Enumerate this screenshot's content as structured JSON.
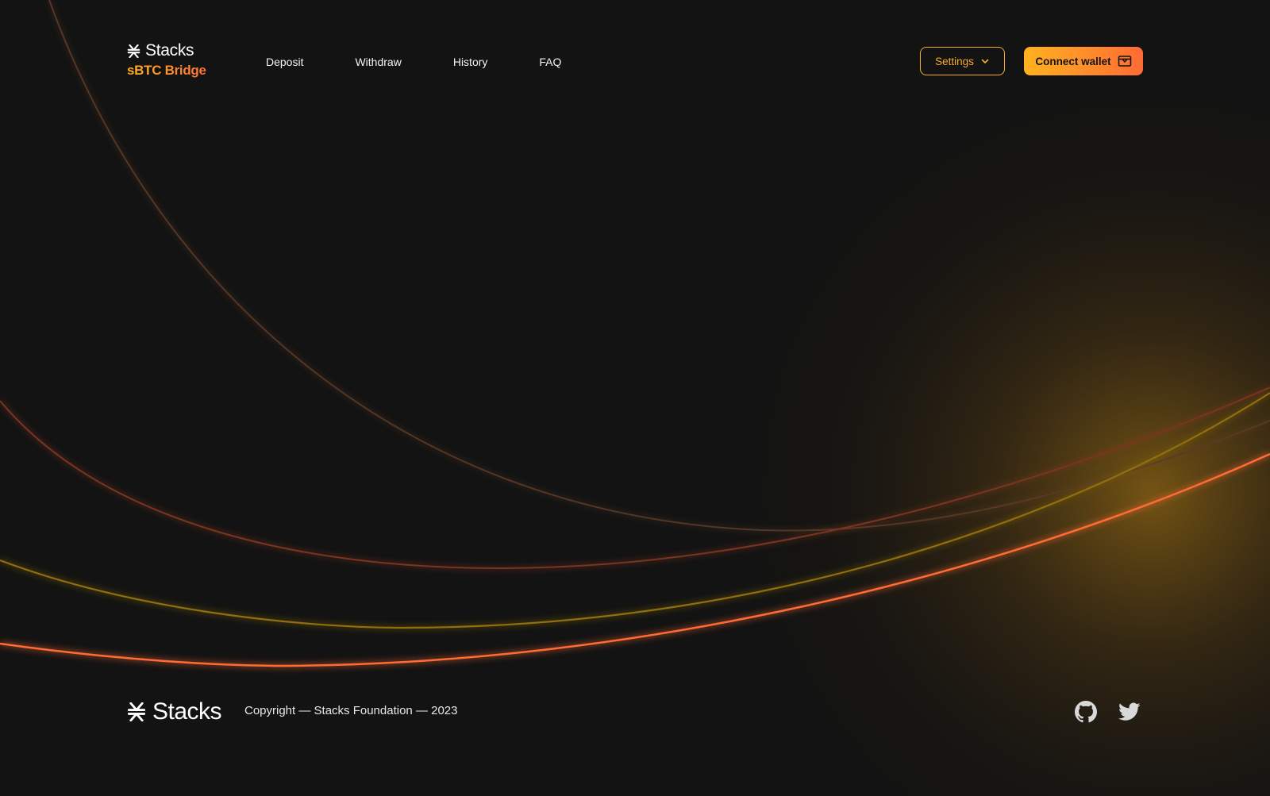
{
  "header": {
    "brand_name": "Stacks",
    "brand_sub": "sBTC Bridge",
    "nav": [
      {
        "label": "Deposit"
      },
      {
        "label": "Withdraw"
      },
      {
        "label": "History"
      },
      {
        "label": "FAQ"
      }
    ],
    "settings_label": "Settings",
    "connect_label": "Connect wallet"
  },
  "footer": {
    "brand_name": "Stacks",
    "copyright": "Copyright — Stacks Foundation — 2023",
    "social": [
      "github-icon",
      "twitter-icon"
    ]
  },
  "colors": {
    "background": "#131313",
    "accent_orange": "#ff6b35",
    "accent_yellow": "#ffb21f",
    "text": "#ffffff"
  }
}
